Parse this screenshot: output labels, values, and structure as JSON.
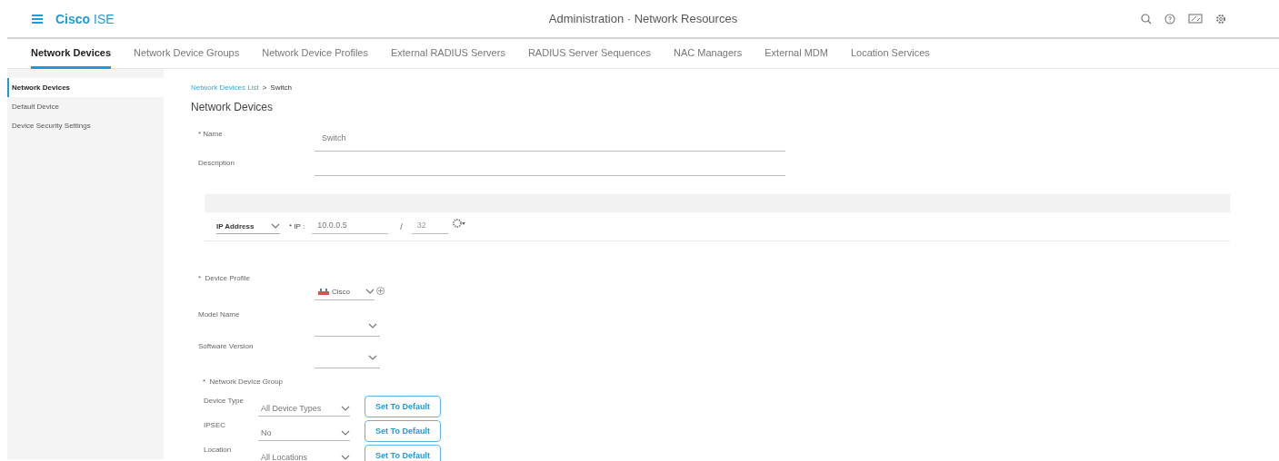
{
  "header": {
    "brand": "Cisco",
    "product": "ISE",
    "title": "Administration · Network Resources"
  },
  "tabs": [
    {
      "label": "Network Devices",
      "selected": true
    },
    {
      "label": "Network Device Groups",
      "selected": false
    },
    {
      "label": "Network Device Profiles",
      "selected": false
    },
    {
      "label": "External RADIUS Servers",
      "selected": false
    },
    {
      "label": "RADIUS Server Sequences",
      "selected": false
    },
    {
      "label": "NAC Managers",
      "selected": false
    },
    {
      "label": "External MDM",
      "selected": false
    },
    {
      "label": "Location Services",
      "selected": false
    }
  ],
  "sidebar": {
    "items": [
      {
        "label": "Network Devices",
        "selected": true
      },
      {
        "label": "Default Device",
        "selected": false
      },
      {
        "label": "Device Security Settings",
        "selected": false
      }
    ]
  },
  "breadcrumb": {
    "link": "Network Devices List",
    "separator": ">",
    "current": "Switch"
  },
  "page_title": "Network Devices",
  "name": {
    "label": "* Name",
    "value": "Switch"
  },
  "description": {
    "label": "Description"
  },
  "ip": {
    "type": "IP Address",
    "label": "* IP :",
    "value": "10.0.0.5",
    "slash": "/",
    "mask": "32"
  },
  "device_profile": {
    "label": "*  Device Profile",
    "value": "Cisco"
  },
  "model_name": {
    "label": "Model Name"
  },
  "software_version": {
    "label": "Software Version"
  },
  "ndg": {
    "title": "*  Network Device Group",
    "rows": [
      {
        "label": "Device Type",
        "value": "All Device Types",
        "button": "Set To Default"
      },
      {
        "label": "IPSEC",
        "value": "No",
        "button": "Set To Default"
      },
      {
        "label": "Location",
        "value": "All Locations",
        "button": "Set To Default"
      }
    ]
  }
}
